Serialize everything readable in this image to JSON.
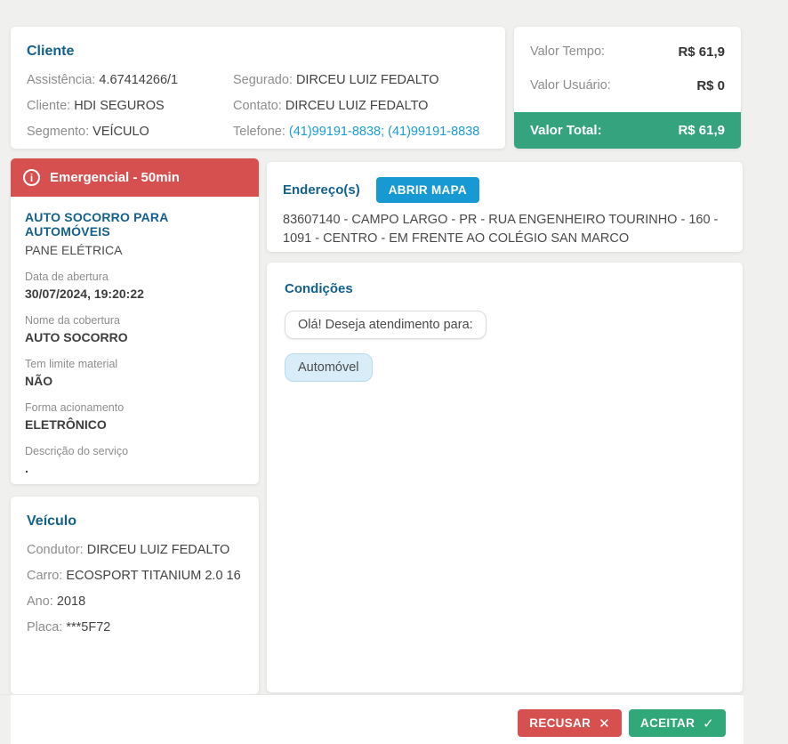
{
  "icons": {
    "info": "i",
    "close": "✕",
    "check": "✓"
  },
  "colors": {
    "background": "#f0f0ef",
    "heading_blue": "#14608d",
    "danger_red": "#d6504f",
    "success_green": "#35a47e",
    "action_blue": "#1799d4",
    "link_blue": "#199cd8"
  },
  "cliente": {
    "title": "Cliente",
    "left": [
      {
        "label": "Assistência:",
        "value": "4.67414266/1"
      },
      {
        "label": "Cliente:",
        "value": "HDI SEGUROS"
      },
      {
        "label": "Segmento:",
        "value": "VEÍCULO"
      }
    ],
    "right": [
      {
        "label": "Segurado:",
        "value": "DIRCEU LUIZ FEDALTO"
      },
      {
        "label": "Contato:",
        "value": "DIRCEU LUIZ FEDALTO"
      },
      {
        "label": "Telefone:",
        "value": "(41)99191-8838; (41)99191-8838"
      }
    ]
  },
  "valores": {
    "rows": [
      {
        "label": "Valor Tempo:",
        "value": "R$ 61,9"
      },
      {
        "label": "Valor Usuário:",
        "value": "R$ 0"
      }
    ],
    "total": {
      "label": "Valor Total:",
      "value": "R$ 61,9"
    }
  },
  "servico": {
    "header": "Emergencial - 50min",
    "title": "AUTO SOCORRO PARA AUTOMÓVEIS",
    "subtitle": "PANE ELÉTRICA",
    "fields": [
      {
        "label": "Data de abertura",
        "value": "30/07/2024, 19:20:22"
      },
      {
        "label": "Nome da cobertura",
        "value": "AUTO SOCORRO"
      },
      {
        "label": "Tem limite material",
        "value": "NÃO"
      },
      {
        "label": "Forma acionamento",
        "value": "ELETRÔNICO"
      },
      {
        "label": "Descrição do serviço",
        "value": "."
      }
    ]
  },
  "veiculo": {
    "title": "Veículo",
    "rows": [
      {
        "label": "Condutor:",
        "value": "DIRCEU LUIZ FEDALTO"
      },
      {
        "label": "Carro:",
        "value": "ECOSPORT TITANIUM 2.0 16"
      },
      {
        "label": "Ano:",
        "value": "2018"
      },
      {
        "label": "Placa:",
        "value": "***5F72"
      }
    ]
  },
  "endereco": {
    "title": "Endereço(s)",
    "map_button": "ABRIR MAPA",
    "address": "83607140 - CAMPO LARGO - PR - RUA ENGENHEIRO TOURINHO - 160 - 1091 - CENTRO - EM FRENTE AO COLÉGIO SAN MARCO"
  },
  "condicoes": {
    "title": "Condições",
    "messages": [
      {
        "text": "Olá! Deseja atendimento para:"
      },
      {
        "text": "Automóvel"
      }
    ]
  },
  "footer": {
    "recusar": "RECUSAR",
    "aceitar": "ACEITAR"
  }
}
